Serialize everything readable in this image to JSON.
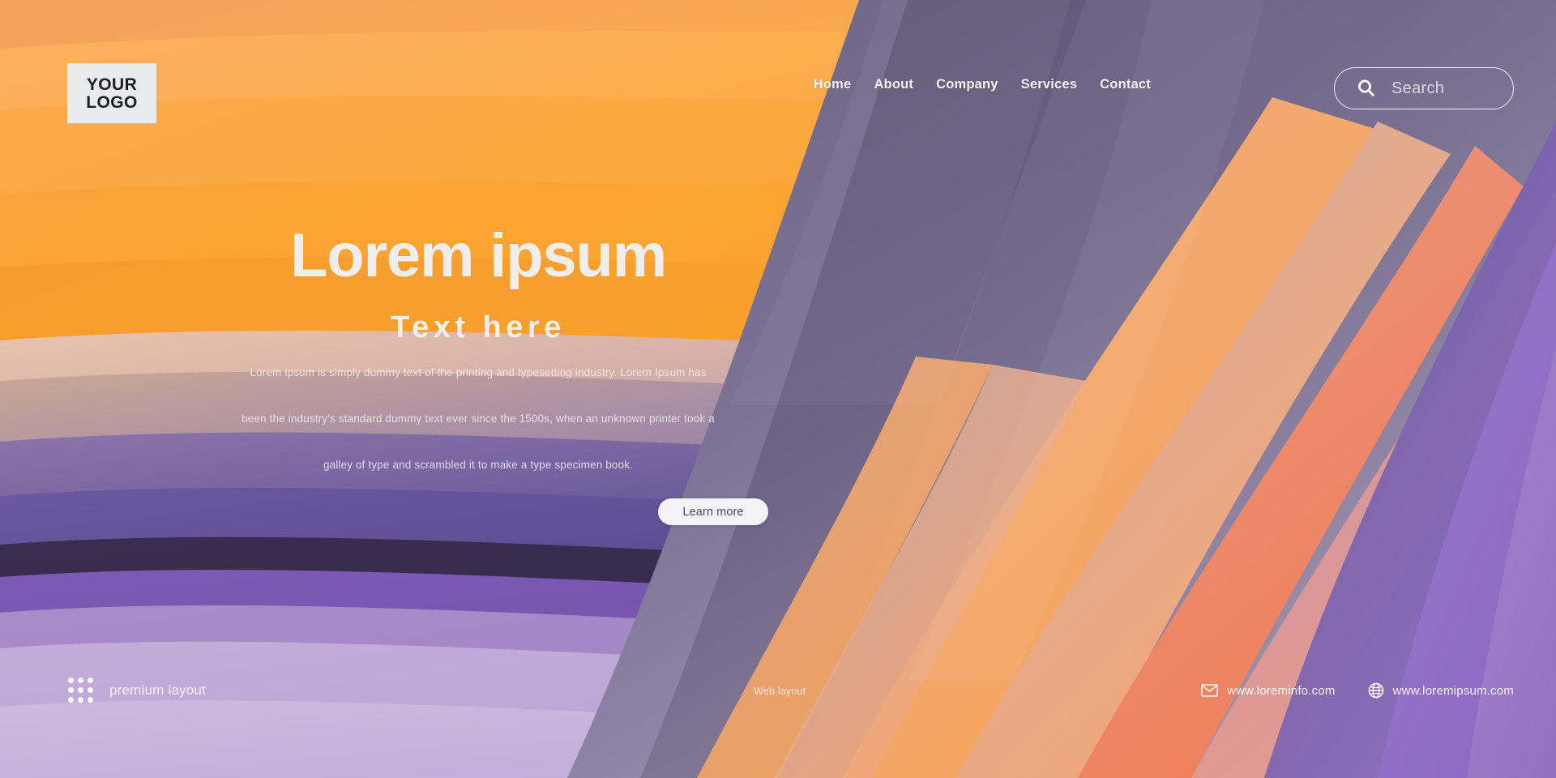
{
  "header": {
    "logo": {
      "line1": "YOUR",
      "line2": "LOGO"
    },
    "nav": [
      {
        "label": "Home"
      },
      {
        "label": "About"
      },
      {
        "label": "Company"
      },
      {
        "label": "Services"
      },
      {
        "label": "Contact"
      }
    ],
    "search": {
      "placeholder": "Search",
      "value": "",
      "icon": "search-icon"
    }
  },
  "hero": {
    "title": "Lorem ipsum",
    "subtitle": "Text here",
    "paragraph": [
      "Lorem ipsum is simply dummy text of the printing and typesetting industry. Lorem Ipsum has",
      "been the industry's standard dummy text ever since the 1500s, when an unknown printer took a",
      "galley of type and scrambled it to make a type specimen book."
    ],
    "cta": {
      "label": "Learn more"
    }
  },
  "footer": {
    "premium": {
      "label": "premium layout",
      "icon": "dot-grid-icon"
    },
    "center": {
      "label": "Web layout"
    },
    "contacts": [
      {
        "label": "www.loreminfo.com",
        "icon": "envelope-icon"
      },
      {
        "label": "www.loremipsum.com",
        "icon": "globe-icon"
      }
    ]
  },
  "colors": {
    "orange_light": "#f9a65a",
    "orange": "#f9a132",
    "orange_deep": "#f2922b",
    "purple_dark": "#3c2b52",
    "purple": "#6d4fa0",
    "purple_light": "#b49bd1",
    "purple_pale": "#c6b0dd",
    "coral": "#ed7b5a",
    "peach": "#f0a77f",
    "logo_bg": "#e8eaec",
    "text_light": "#f0eeec",
    "cta_bg": "#f3f3f5",
    "cta_text": "#4a4a50"
  }
}
